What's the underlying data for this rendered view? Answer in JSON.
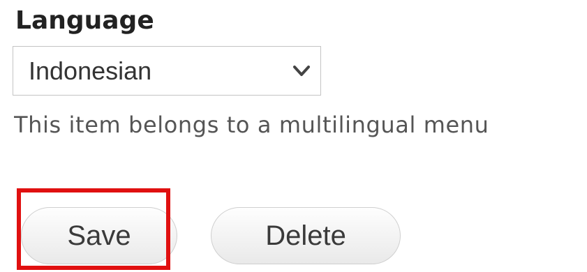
{
  "language_field": {
    "label": "Language",
    "selected_value": "Indonesian",
    "dropdown_icon": "chevron-down-icon"
  },
  "description": "This item belongs to a multilingual menu",
  "actions": {
    "save_label": "Save",
    "delete_label": "Delete"
  },
  "annotation": {
    "highlight_color": "#e01010",
    "highlighted_element": "save-button"
  }
}
